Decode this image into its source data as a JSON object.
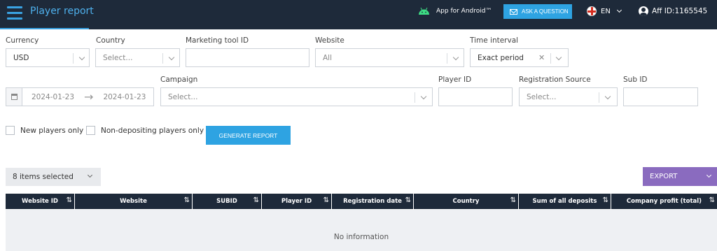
{
  "header": {
    "title": "Player report",
    "android_label": "App for Android™",
    "ask_label": "ASK A QUESTION",
    "language": "EN",
    "aff_id": "Aff ID:1165545"
  },
  "filters": {
    "currency": {
      "label": "Currency",
      "value": "USD"
    },
    "country": {
      "label": "Country",
      "placeholder": "Select..."
    },
    "marketing_tool": {
      "label": "Marketing tool ID",
      "value": ""
    },
    "website": {
      "label": "Website",
      "value": "All"
    },
    "time_interval": {
      "label": "Time interval",
      "value": "Exact period"
    },
    "date_from": "2024-01-23",
    "date_arrow": "→",
    "date_to": "2024-01-23",
    "campaign": {
      "label": "Campaign",
      "placeholder": "Select..."
    },
    "player_id": {
      "label": "Player ID",
      "value": ""
    },
    "registration_source": {
      "label": "Registration Source",
      "placeholder": "Select..."
    },
    "sub_id": {
      "label": "Sub ID",
      "value": ""
    },
    "new_players_only": "New players only",
    "non_depositing_only": "Non-depositing players only",
    "generate_label": "GENERATE REPORT"
  },
  "toolbar": {
    "items_selected": "8 items selected",
    "export_label": "EXPORT"
  },
  "table": {
    "columns": [
      "Website ID",
      "Website",
      "SUBID",
      "Player ID",
      "Registration date",
      "Country",
      "Sum of all deposits",
      "Company profit (total)"
    ],
    "empty_text": "No information"
  },
  "colors": {
    "topbar": "#1e2a3a",
    "accent": "#2ea3e2",
    "export": "#8a6bbf"
  }
}
